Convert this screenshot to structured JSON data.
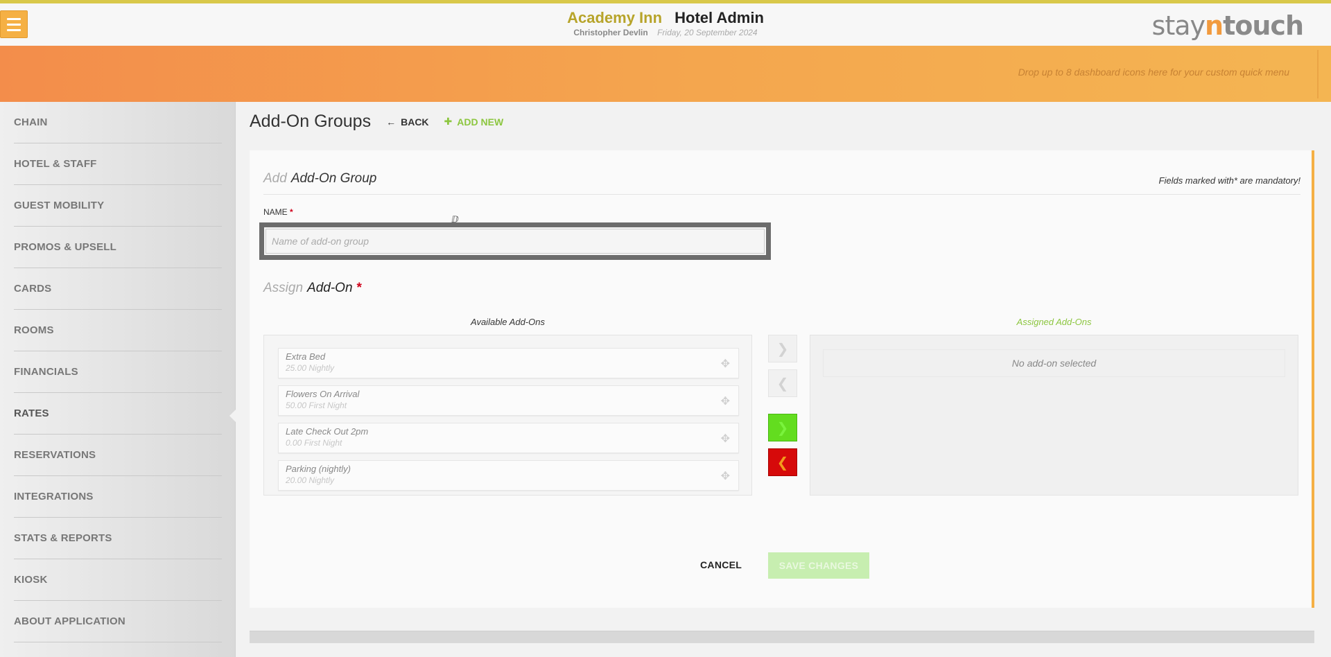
{
  "header": {
    "hotel_name": "Academy Inn",
    "app_name": "Hotel Admin",
    "user": "Christopher Devlin",
    "date": "Friday, 20 September 2024",
    "logo": {
      "part1": "stay",
      "part2": "n",
      "part3": "touch"
    },
    "menu_icon": "hamburger-icon"
  },
  "dashboard": {
    "hint": "Drop up to 8 dashboard icons here for your custom quick menu"
  },
  "sidebar": {
    "items": [
      {
        "label": "CHAIN"
      },
      {
        "label": "HOTEL & STAFF"
      },
      {
        "label": "GUEST MOBILITY"
      },
      {
        "label": "PROMOS & UPSELL"
      },
      {
        "label": "CARDS"
      },
      {
        "label": "ROOMS"
      },
      {
        "label": "FINANCIALS"
      },
      {
        "label": "RATES",
        "active": true
      },
      {
        "label": "RESERVATIONS"
      },
      {
        "label": "INTEGRATIONS"
      },
      {
        "label": "STATS & REPORTS"
      },
      {
        "label": "KIOSK"
      },
      {
        "label": "ABOUT APPLICATION"
      }
    ]
  },
  "page": {
    "title": "Add-On Groups",
    "back_label": "BACK",
    "add_new_label": "ADD NEW"
  },
  "form": {
    "heading_light": "Add",
    "heading": "Add-On Group",
    "mandatory_note": "Fields marked with* are mandatory!",
    "name_label": "NAME",
    "required_mark": "*",
    "name_placeholder": "Name of add-on group",
    "name_value": "",
    "assign_light": "Assign",
    "assign_title": "Add-On",
    "available_caption": "Available Add-Ons",
    "assigned_caption": "Assigned Add-Ons",
    "available_addons": [
      {
        "name": "Extra Bed",
        "price": "25.00 Nightly"
      },
      {
        "name": "Flowers On Arrival",
        "price": "50.00 First Night"
      },
      {
        "name": "Late Check Out 2pm",
        "price": "0.00 First Night"
      },
      {
        "name": "Parking (nightly)",
        "price": "20.00 Nightly"
      }
    ],
    "assigned_empty": "No add-on selected",
    "cancel_label": "CANCEL",
    "save_label": "SAVE CHANGES"
  },
  "colors": {
    "accent_orange": "#f5b044",
    "accent_green": "#8cc63f",
    "hotel_name": "#b7a42a",
    "required_red": "#d0021b"
  }
}
